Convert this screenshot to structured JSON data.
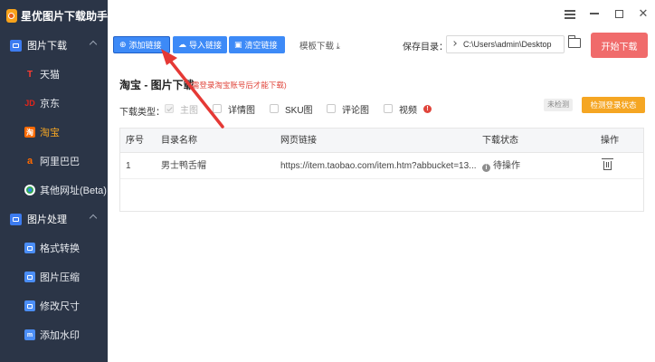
{
  "app": {
    "title": "星优图片下载助手"
  },
  "sidebar": {
    "sections": [
      {
        "label": "图片下载",
        "items": [
          {
            "label": "天猫",
            "icon": "tmall-icon"
          },
          {
            "label": "京东",
            "icon": "jd-icon"
          },
          {
            "label": "淘宝",
            "icon": "taobao-icon",
            "active": true
          },
          {
            "label": "阿里巴巴",
            "icon": "alibaba-icon"
          },
          {
            "label": "其他网址(Beta)",
            "icon": "globe-icon"
          }
        ]
      },
      {
        "label": "图片处理",
        "items": [
          {
            "label": "格式转换",
            "icon": "format-convert-icon"
          },
          {
            "label": "图片压缩",
            "icon": "compress-icon"
          },
          {
            "label": "修改尺寸",
            "icon": "resize-icon"
          },
          {
            "label": "添加水印",
            "icon": "watermark-icon"
          }
        ]
      }
    ]
  },
  "toolbar": {
    "add_link": "添加链接",
    "import_link": "导入链接",
    "clear_link": "清空链接",
    "template_download": "模板下载",
    "save_dir_label": "保存目录：",
    "save_dir_value": "C:\\Users\\admin\\Desktop",
    "start_download": "开始下载"
  },
  "panel": {
    "title": "淘宝 - 图片下载",
    "note": "(需登录淘宝账号后才能下载)",
    "download_type_label": "下载类型：",
    "options": [
      {
        "label": "主图",
        "disabled": true
      },
      {
        "label": "详情图"
      },
      {
        "label": "SKU图"
      },
      {
        "label": "评论图"
      },
      {
        "label": "视频"
      }
    ],
    "login_status": "未检测",
    "detect_login": "检测登录状态"
  },
  "table": {
    "columns": [
      "序号",
      "目录名称",
      "网页链接",
      "下载状态",
      "操作"
    ],
    "rows": [
      {
        "index": "1",
        "name": "男士鸭舌帽",
        "url": "https://item.taobao.com/item.htm?abbucket=13...",
        "status": "待操作"
      }
    ]
  },
  "colors": {
    "sidebar_bg": "#2b3547",
    "primary": "#3d8af7",
    "start_btn": "#f06b6b",
    "detect_btn": "#f5a623",
    "active_nav": "#f5a623",
    "annotation": "#e53935"
  }
}
